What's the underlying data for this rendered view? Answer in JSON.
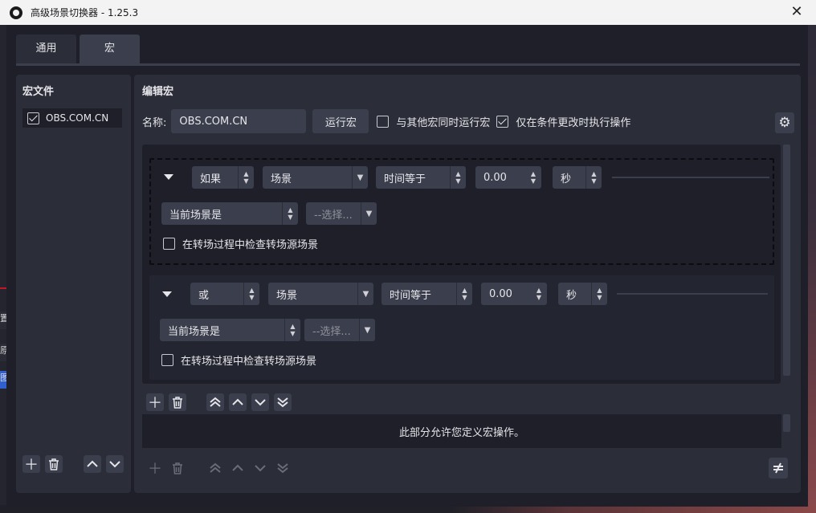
{
  "window": {
    "title": "高级场景切换器 - 1.25.3"
  },
  "tabs": [
    {
      "label": "通用"
    },
    {
      "label": "宏"
    }
  ],
  "macro_files": {
    "title": "宏文件",
    "items": [
      {
        "label": "OBS.COM.CN",
        "checked": true
      }
    ]
  },
  "edit": {
    "title": "编辑宏",
    "name_label": "名称:",
    "name_value": "OBS.COM.CN",
    "run_button": "运行宏",
    "parallel_label": "与其他宏同时运行宏",
    "parallel_checked": false,
    "on_change_label": "仅在条件更改时执行操作",
    "on_change_checked": true
  },
  "conditions": [
    {
      "logic": "如果",
      "type": "场景",
      "compare": "时间等于",
      "duration": "0.00",
      "unit": "秒",
      "scene_mode": "当前场景是",
      "scene_select": "--选择...",
      "transition_label": "在转场过程中检查转场源场景",
      "transition_checked": false
    },
    {
      "logic": "或",
      "type": "场景",
      "compare": "时间等于",
      "duration": "0.00",
      "unit": "秒",
      "scene_mode": "当前场景是",
      "scene_select": "--选择...",
      "transition_label": "在转场过程中检查转场源场景",
      "transition_checked": false
    }
  ],
  "actions": {
    "hint": "此部分允许您定义宏操作。"
  },
  "background_fragments": [
    "置",
    "原",
    "图"
  ],
  "colors": {
    "panel": "#2b2d38",
    "field": "#3b3e4c",
    "area": "#1e1f29",
    "accent_red": "#c2172a",
    "accent_blue": "#2f5fd0"
  }
}
